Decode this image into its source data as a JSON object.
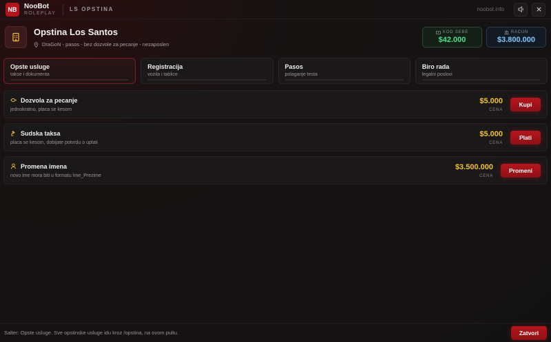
{
  "app": {
    "logo_text": "NB",
    "brand_name": "NooBot",
    "brand_sub": "ROLEPLAY",
    "section": "LS OPSTINA",
    "site": "noobot.info"
  },
  "header": {
    "title": "Opstina Los Santos",
    "subtitle": "DraGoN - pasos - bez dozvole za pecanje - nezaposlen"
  },
  "money": {
    "cash_label": "KOD SEBE",
    "cash_value": "$42.000",
    "bank_label": "RACUN",
    "bank_value": "$3.800.000"
  },
  "tabs": [
    {
      "label": "Opste usluge",
      "sub": "takse i dokumenta"
    },
    {
      "label": "Registracija",
      "sub": "vozila i tablice"
    },
    {
      "label": "Pasos",
      "sub": "polaganje testa"
    },
    {
      "label": "Biro rada",
      "sub": "legalni poslovi"
    }
  ],
  "services": [
    {
      "title": "Dozvola za pecanje",
      "sub": "jednokratno, placa se kesom",
      "price": "$5.000",
      "price_label": "CENA",
      "action": "Kupi",
      "icon": "fish-icon"
    },
    {
      "title": "Sudska taksa",
      "sub": "placa se kesom, dobijate potvrdu o uplati",
      "price": "$5.000",
      "price_label": "CENA",
      "action": "Plati",
      "icon": "gavel-icon"
    },
    {
      "title": "Promena imena",
      "sub": "novo ime mora biti u formatu Ime_Prezime",
      "price": "$3.500.000",
      "price_label": "CENA",
      "action": "Promeni",
      "icon": "user-icon"
    }
  ],
  "footer": {
    "text": "Salter: Opste usluge. Sve opstinske usluge idu kroz /opstina, na ovom pultu.",
    "close_label": "Zatvori"
  },
  "colors": {
    "accent": "#b3141b",
    "price": "#f2c230",
    "cash": "#4fe08c",
    "bank": "#7cc8ff"
  }
}
